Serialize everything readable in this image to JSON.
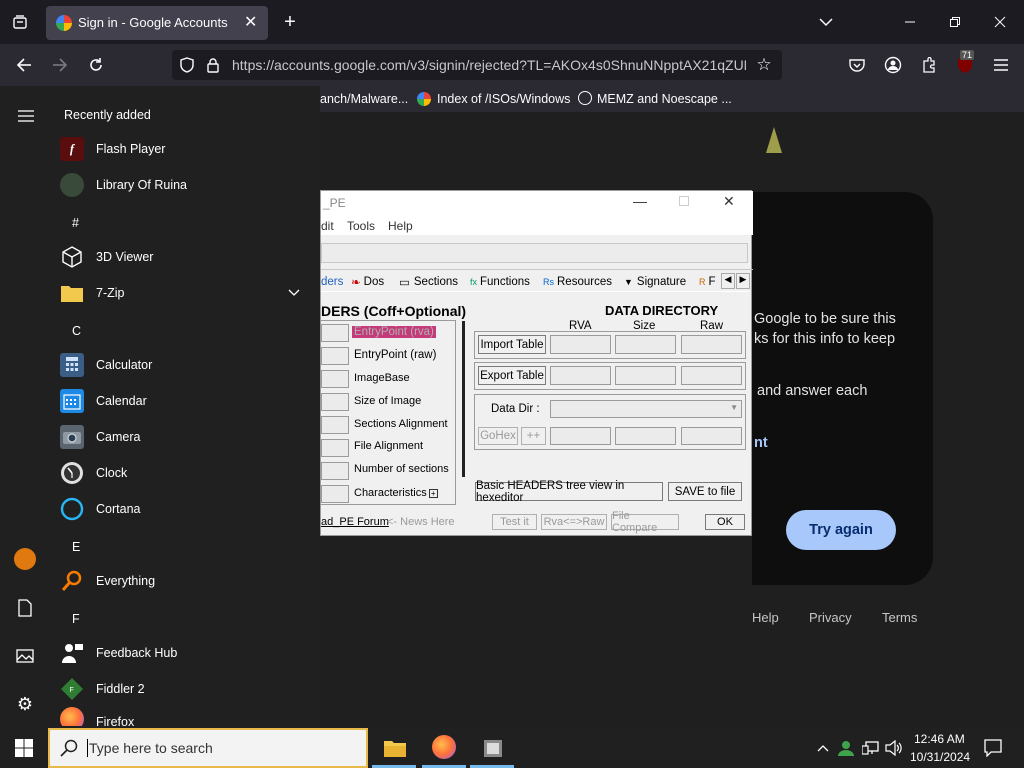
{
  "browser": {
    "tab_title": "Sign in - Google Accounts",
    "url": "https://accounts.google.com/v3/signin/rejected?TL=AKOx4s0ShnuNNpptAX21qZUN",
    "bookmarks": [
      "anch/Malware...",
      "Index of /ISOs/Windows",
      "MEMZ and Noescape ..."
    ],
    "extension_badge": "71"
  },
  "google": {
    "line1": "Google to be sure this",
    "line2": "ks for this info to keep",
    "line3": "and answer each",
    "line4": "nt",
    "try_again": "Try again",
    "footer": {
      "help": "Help",
      "privacy": "Privacy",
      "terms": "Terms"
    }
  },
  "start_menu": {
    "recently_added": "Recently added",
    "items": [
      {
        "label": "Flash Player",
        "icon": "flash-player-icon",
        "color": "#8b1a1a"
      },
      {
        "label": "Library Of Ruina",
        "icon": "library-of-ruina-icon",
        "color": "#3a4a3a"
      },
      {
        "letter": "#"
      },
      {
        "label": "3D Viewer",
        "icon": "cube-icon",
        "color": "#202020"
      },
      {
        "label": "7-Zip",
        "icon": "folder-icon",
        "color": "#f2c94c"
      },
      {
        "letter": "C"
      },
      {
        "label": "Calculator",
        "icon": "calculator-icon",
        "color": "#3b6ea5"
      },
      {
        "label": "Calendar",
        "icon": "calendar-icon",
        "color": "#1e88e5"
      },
      {
        "label": "Camera",
        "icon": "camera-icon",
        "color": "#5a6570"
      },
      {
        "label": "Clock",
        "icon": "clock-icon",
        "color": "#e0e0e0"
      },
      {
        "label": "Cortana",
        "icon": "cortana-icon",
        "color": "#1e88e5"
      },
      {
        "letter": "E"
      },
      {
        "label": "Everything",
        "icon": "magnifier-icon",
        "color": "#f57c00"
      },
      {
        "letter": "F"
      },
      {
        "label": "Feedback Hub",
        "icon": "feedback-hub-icon",
        "color": "#ffffff"
      },
      {
        "label": "Fiddler 2",
        "icon": "fiddler-icon",
        "color": "#2e7d32"
      },
      {
        "label": "Firefox",
        "icon": "firefox-icon",
        "color": "#ff7139"
      }
    ]
  },
  "studpe": {
    "title": "_PE",
    "menu": [
      "dit",
      "Tools",
      "Help"
    ],
    "tabs": [
      "ders",
      "Dos",
      "Sections",
      "Functions",
      "Resources",
      "Signature",
      "F"
    ],
    "headers_title": "DERS (Coff+Optional)",
    "header_rows": [
      "EntryPoint (rva)",
      "EntryPoint (raw)",
      "ImageBase",
      "Size of Image",
      "Sections Alignment",
      "File Alignment",
      "Number of sections",
      "Characteristics"
    ],
    "dd_title": "DATA  DIRECTORY",
    "dd_cols": [
      "RVA",
      "Size",
      "Raw"
    ],
    "import_table": "Import Table",
    "export_table": "Export Table",
    "data_dir": "Data Dir :",
    "gohex": "GoHex",
    "plusplus": "++",
    "basic_headers": "Basic HEADERS tree view in hexeditor",
    "save_to_file": "SAVE to file",
    "forum": "ad_PE Forum",
    "news": "<- News Here",
    "test_it": "Test it",
    "rva_raw": "Rva<=>Raw",
    "file_compare": "File Compare",
    "ok": "OK"
  },
  "taskbar": {
    "search_placeholder": "Type here to search",
    "time": "12:46 AM",
    "date": "10/31/2024"
  }
}
